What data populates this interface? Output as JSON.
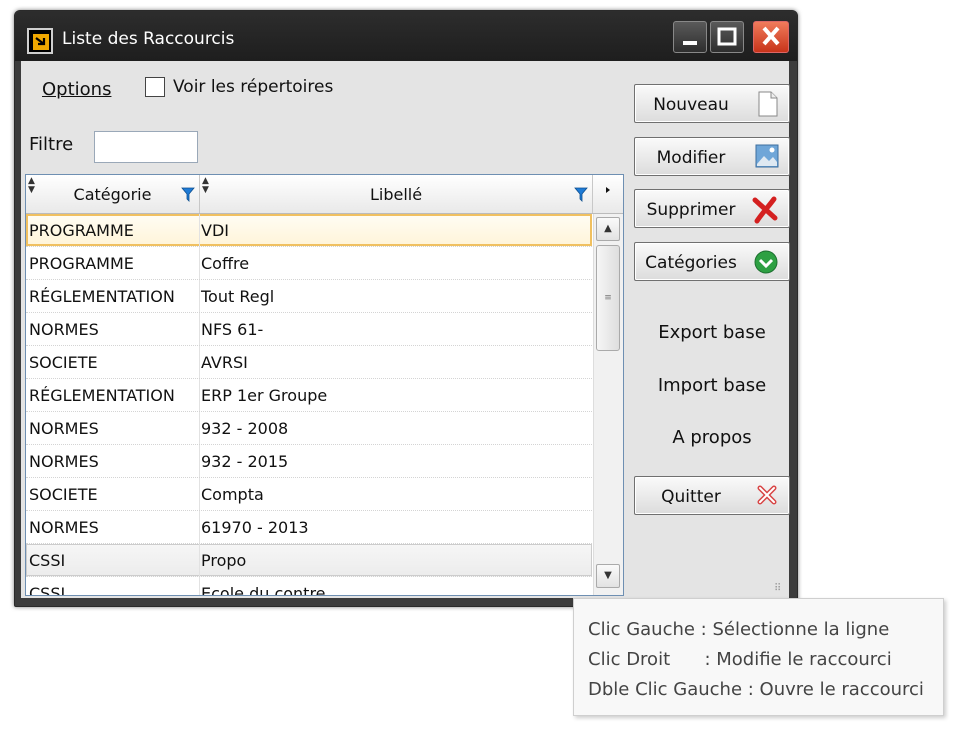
{
  "window": {
    "title": "Liste des Raccourcis"
  },
  "toolbar": {
    "options_label": "Options",
    "show_dirs_label": "Voir les répertoires",
    "show_dirs_checked": false,
    "filter_label": "Filtre",
    "filter_value": ""
  },
  "grid": {
    "columns": [
      "Catégorie",
      "Libellé"
    ],
    "rows": [
      {
        "category": "PROGRAMME",
        "label": "VDI"
      },
      {
        "category": "PROGRAMME",
        "label": "Coffre"
      },
      {
        "category": "RÉGLEMENTATION",
        "label": "Tout Regl"
      },
      {
        "category": "NORMES",
        "label": "NFS 61-"
      },
      {
        "category": "SOCIETE",
        "label": "AVRSI"
      },
      {
        "category": "RÉGLEMENTATION",
        "label": "ERP 1er Groupe"
      },
      {
        "category": "NORMES",
        "label": "932 - 2008"
      },
      {
        "category": "NORMES",
        "label": "932 - 2015"
      },
      {
        "category": "SOCIETE",
        "label": "Compta"
      },
      {
        "category": "NORMES",
        "label": "61970 - 2013"
      },
      {
        "category": "CSSI",
        "label": "Propo"
      },
      {
        "category": "CSSI",
        "label": "Ecole du contre"
      }
    ]
  },
  "buttons": {
    "new": "Nouveau",
    "edit": "Modifier",
    "delete": "Supprimer",
    "categories": "Catégories",
    "export": "Export base",
    "import": "Import base",
    "about": "A propos",
    "quit": "Quitter"
  },
  "tooltip": {
    "lines": [
      "Clic Gauche : Sélectionne la ligne",
      "Clic Droit      : Modifie le raccourci",
      "Dble Clic Gauche : Ouvre le raccourci"
    ]
  },
  "colors": {
    "selection_border": "#f0c060",
    "delete_icon": "#d42020",
    "categories_icon": "#2ea043",
    "close_button": "#d84525"
  }
}
